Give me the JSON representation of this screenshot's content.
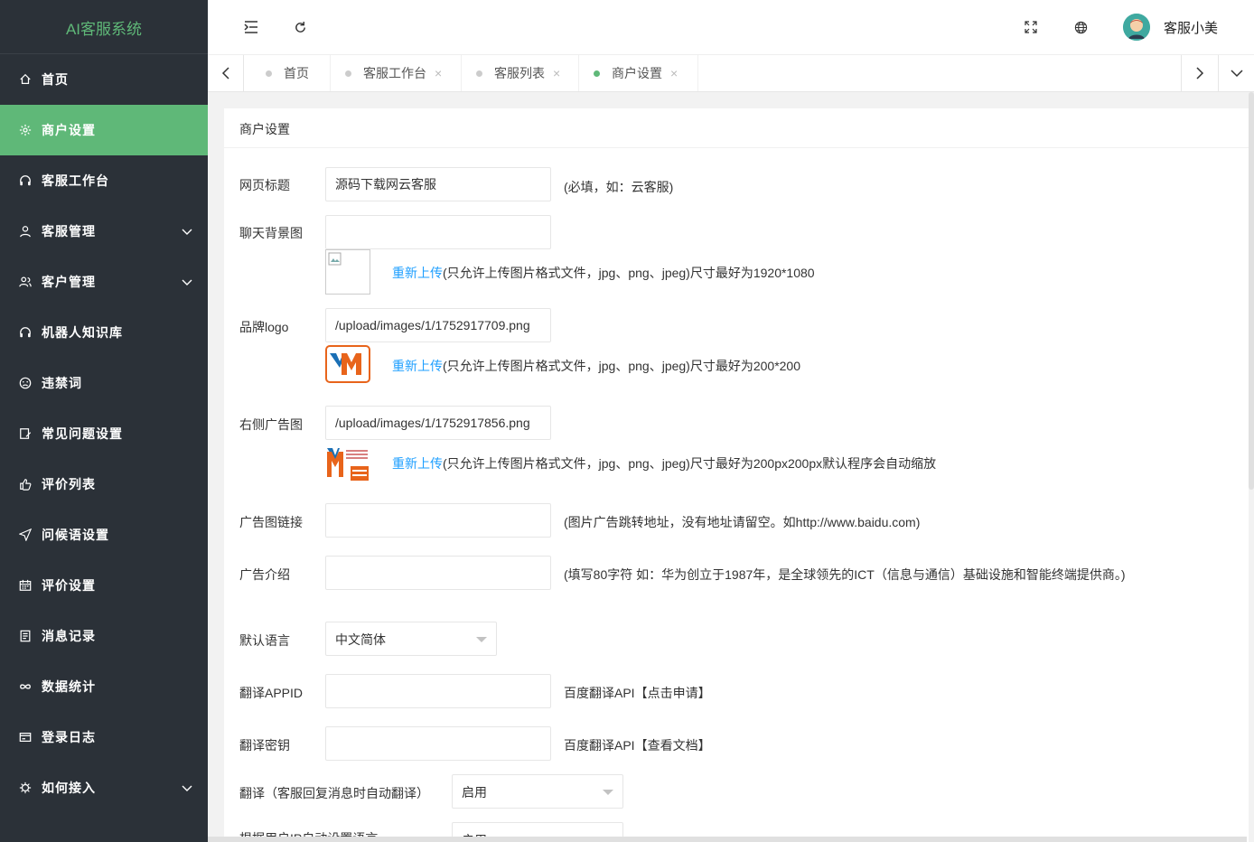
{
  "app": {
    "title": "AI客服系统"
  },
  "sidebar": {
    "items": [
      {
        "label": "首页",
        "icon": "home-icon"
      },
      {
        "label": "商户设置",
        "icon": "gear-icon"
      },
      {
        "label": "客服工作台",
        "icon": "headset-icon"
      },
      {
        "label": "客服管理",
        "icon": "user-icon"
      },
      {
        "label": "客户管理",
        "icon": "users-icon"
      },
      {
        "label": "机器人知识库",
        "icon": "robot-icon"
      },
      {
        "label": "违禁词",
        "icon": "frown-icon"
      },
      {
        "label": "常见问题设置",
        "icon": "edit-icon"
      },
      {
        "label": "评价列表",
        "icon": "thumb-up-icon"
      },
      {
        "label": "问候语设置",
        "icon": "send-icon"
      },
      {
        "label": "评价设置",
        "icon": "calendar-icon"
      },
      {
        "label": "消息记录",
        "icon": "note-icon"
      },
      {
        "label": "数据统计",
        "icon": "infinity-icon"
      },
      {
        "label": "登录日志",
        "icon": "card-icon"
      },
      {
        "label": "如何接入",
        "icon": "bug-icon"
      }
    ]
  },
  "header": {
    "username": "客服小美"
  },
  "tabs": [
    {
      "label": "首页"
    },
    {
      "label": "客服工作台",
      "close": "×"
    },
    {
      "label": "客服列表",
      "close": "×"
    },
    {
      "label": "商户设置",
      "close": "×"
    }
  ],
  "form": {
    "card_title": "商户设置",
    "page_title": {
      "label": "网页标题",
      "value": "源码下载网云客服",
      "tip": "(必填，如：云客服)"
    },
    "chat_bg": {
      "label": "聊天背景图",
      "value": "",
      "upload": "重新上传",
      "tip": "(只允许上传图片格式文件，jpg、png、jpeg)尺寸最好为1920*1080"
    },
    "brand_logo": {
      "label": "品牌logo",
      "value": "/upload/images/1/1752917709.png",
      "upload": "重新上传",
      "tip": "(只允许上传图片格式文件，jpg、png、jpeg)尺寸最好为200*200"
    },
    "right_ad": {
      "label": "右侧广告图",
      "value": "/upload/images/1/1752917856.png",
      "upload": "重新上传",
      "tip": "(只允许上传图片格式文件，jpg、png、jpeg)尺寸最好为200px200px默认程序会自动缩放"
    },
    "ad_link": {
      "label": "广告图链接",
      "value": "",
      "tip": "(图片广告跳转地址，没有地址请留空。如http://www.baidu.com)"
    },
    "ad_intro": {
      "label": "广告介绍",
      "value": "",
      "tip": "(填写80字符 如：华为创立于1987年，是全球领先的ICT（信息与通信）基础设施和智能终端提供商。)"
    },
    "default_lang": {
      "label": "默认语言",
      "value": "中文简体"
    },
    "trans_appid": {
      "label": "翻译APPID",
      "value": "",
      "tip": "百度翻译API【点击申请】"
    },
    "trans_key": {
      "label": "翻译密钥",
      "value": "",
      "tip": "百度翻译API【查看文档】"
    },
    "auto_trans": {
      "label": "翻译（客服回复消息时自动翻译）",
      "value": "启用"
    },
    "ip_lang": {
      "label": "根据用户IP自动设置语言",
      "value": "启用"
    }
  },
  "colors": {
    "accent": "#5fb878",
    "sidebar_bg": "#2b3138",
    "link": "#1e9fff"
  }
}
